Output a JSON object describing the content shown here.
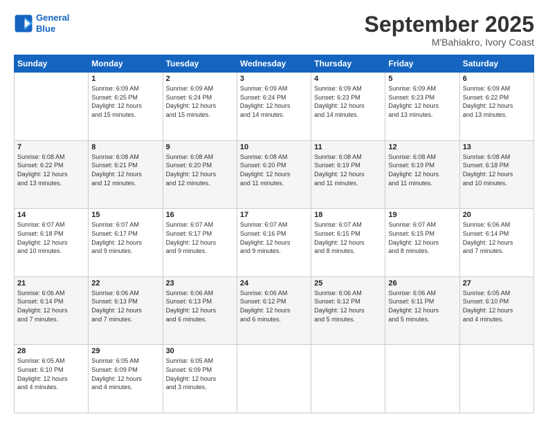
{
  "header": {
    "logo_line1": "General",
    "logo_line2": "Blue",
    "month": "September 2025",
    "location": "M'Bahiakro, Ivory Coast"
  },
  "weekdays": [
    "Sunday",
    "Monday",
    "Tuesday",
    "Wednesday",
    "Thursday",
    "Friday",
    "Saturday"
  ],
  "weeks": [
    [
      {
        "day": "",
        "text": ""
      },
      {
        "day": "1",
        "text": "Sunrise: 6:09 AM\nSunset: 6:25 PM\nDaylight: 12 hours\nand 15 minutes."
      },
      {
        "day": "2",
        "text": "Sunrise: 6:09 AM\nSunset: 6:24 PM\nDaylight: 12 hours\nand 15 minutes."
      },
      {
        "day": "3",
        "text": "Sunrise: 6:09 AM\nSunset: 6:24 PM\nDaylight: 12 hours\nand 14 minutes."
      },
      {
        "day": "4",
        "text": "Sunrise: 6:09 AM\nSunset: 6:23 PM\nDaylight: 12 hours\nand 14 minutes."
      },
      {
        "day": "5",
        "text": "Sunrise: 6:09 AM\nSunset: 6:23 PM\nDaylight: 12 hours\nand 13 minutes."
      },
      {
        "day": "6",
        "text": "Sunrise: 6:09 AM\nSunset: 6:22 PM\nDaylight: 12 hours\nand 13 minutes."
      }
    ],
    [
      {
        "day": "7",
        "text": "Sunrise: 6:08 AM\nSunset: 6:22 PM\nDaylight: 12 hours\nand 13 minutes."
      },
      {
        "day": "8",
        "text": "Sunrise: 6:08 AM\nSunset: 6:21 PM\nDaylight: 12 hours\nand 12 minutes."
      },
      {
        "day": "9",
        "text": "Sunrise: 6:08 AM\nSunset: 6:20 PM\nDaylight: 12 hours\nand 12 minutes."
      },
      {
        "day": "10",
        "text": "Sunrise: 6:08 AM\nSunset: 6:20 PM\nDaylight: 12 hours\nand 11 minutes."
      },
      {
        "day": "11",
        "text": "Sunrise: 6:08 AM\nSunset: 6:19 PM\nDaylight: 12 hours\nand 11 minutes."
      },
      {
        "day": "12",
        "text": "Sunrise: 6:08 AM\nSunset: 6:19 PM\nDaylight: 12 hours\nand 11 minutes."
      },
      {
        "day": "13",
        "text": "Sunrise: 6:08 AM\nSunset: 6:18 PM\nDaylight: 12 hours\nand 10 minutes."
      }
    ],
    [
      {
        "day": "14",
        "text": "Sunrise: 6:07 AM\nSunset: 6:18 PM\nDaylight: 12 hours\nand 10 minutes."
      },
      {
        "day": "15",
        "text": "Sunrise: 6:07 AM\nSunset: 6:17 PM\nDaylight: 12 hours\nand 9 minutes."
      },
      {
        "day": "16",
        "text": "Sunrise: 6:07 AM\nSunset: 6:17 PM\nDaylight: 12 hours\nand 9 minutes."
      },
      {
        "day": "17",
        "text": "Sunrise: 6:07 AM\nSunset: 6:16 PM\nDaylight: 12 hours\nand 9 minutes."
      },
      {
        "day": "18",
        "text": "Sunrise: 6:07 AM\nSunset: 6:15 PM\nDaylight: 12 hours\nand 8 minutes."
      },
      {
        "day": "19",
        "text": "Sunrise: 6:07 AM\nSunset: 6:15 PM\nDaylight: 12 hours\nand 8 minutes."
      },
      {
        "day": "20",
        "text": "Sunrise: 6:06 AM\nSunset: 6:14 PM\nDaylight: 12 hours\nand 7 minutes."
      }
    ],
    [
      {
        "day": "21",
        "text": "Sunrise: 6:06 AM\nSunset: 6:14 PM\nDaylight: 12 hours\nand 7 minutes."
      },
      {
        "day": "22",
        "text": "Sunrise: 6:06 AM\nSunset: 6:13 PM\nDaylight: 12 hours\nand 7 minutes."
      },
      {
        "day": "23",
        "text": "Sunrise: 6:06 AM\nSunset: 6:13 PM\nDaylight: 12 hours\nand 6 minutes."
      },
      {
        "day": "24",
        "text": "Sunrise: 6:06 AM\nSunset: 6:12 PM\nDaylight: 12 hours\nand 6 minutes."
      },
      {
        "day": "25",
        "text": "Sunrise: 6:06 AM\nSunset: 6:12 PM\nDaylight: 12 hours\nand 5 minutes."
      },
      {
        "day": "26",
        "text": "Sunrise: 6:06 AM\nSunset: 6:11 PM\nDaylight: 12 hours\nand 5 minutes."
      },
      {
        "day": "27",
        "text": "Sunrise: 6:05 AM\nSunset: 6:10 PM\nDaylight: 12 hours\nand 4 minutes."
      }
    ],
    [
      {
        "day": "28",
        "text": "Sunrise: 6:05 AM\nSunset: 6:10 PM\nDaylight: 12 hours\nand 4 minutes."
      },
      {
        "day": "29",
        "text": "Sunrise: 6:05 AM\nSunset: 6:09 PM\nDaylight: 12 hours\nand 4 minutes."
      },
      {
        "day": "30",
        "text": "Sunrise: 6:05 AM\nSunset: 6:09 PM\nDaylight: 12 hours\nand 3 minutes."
      },
      {
        "day": "",
        "text": ""
      },
      {
        "day": "",
        "text": ""
      },
      {
        "day": "",
        "text": ""
      },
      {
        "day": "",
        "text": ""
      }
    ]
  ]
}
